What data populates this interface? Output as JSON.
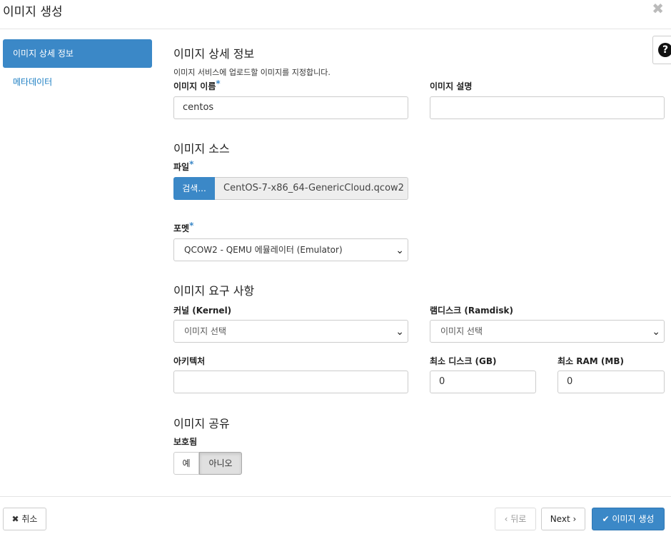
{
  "header": {
    "title": "이미지 생성",
    "close_glyph": "✖"
  },
  "nav": {
    "items": [
      {
        "label": "이미지 상세 정보",
        "active": true
      },
      {
        "label": "메타데이터",
        "active": false
      }
    ]
  },
  "help": {
    "glyph": "?"
  },
  "details": {
    "title": "이미지 상세 정보",
    "description": "이미지 서비스에 업로드할 이미지를 지정합니다.",
    "name_label": "이미지 이름",
    "name_value": "centos",
    "desc_label": "이미지 설명",
    "desc_value": ""
  },
  "source": {
    "title": "이미지 소스",
    "file_label": "파일",
    "browse_label": "검색...",
    "file_name": "CentOS-7-x86_64-GenericCloud.qcow2",
    "format_label": "포멧",
    "format_value": "QCOW2 - QEMU 에뮬레이터 (Emulator)"
  },
  "requirements": {
    "title": "이미지 요구 사항",
    "kernel_label": "커널 (Kernel)",
    "kernel_value": "이미지 선택",
    "ramdisk_label": "램디스크 (Ramdisk)",
    "ramdisk_value": "이미지 선택",
    "arch_label": "아키텍처",
    "arch_value": "",
    "min_disk_label": "최소 디스크 (GB)",
    "min_disk_value": "0",
    "min_ram_label": "최소 RAM (MB)",
    "min_ram_value": "0"
  },
  "sharing": {
    "title": "이미지 공유",
    "protected_label": "보호됨",
    "yes_label": "예",
    "no_label": "아니오",
    "selected": "아니오"
  },
  "required_mark": "*",
  "footer": {
    "cancel_label": "✖ 취소",
    "back_label": "‹ 뒤로",
    "next_label": "Next ›",
    "create_label": "✔ 이미지 생성"
  },
  "colors": {
    "accent": "#3b88c7"
  }
}
